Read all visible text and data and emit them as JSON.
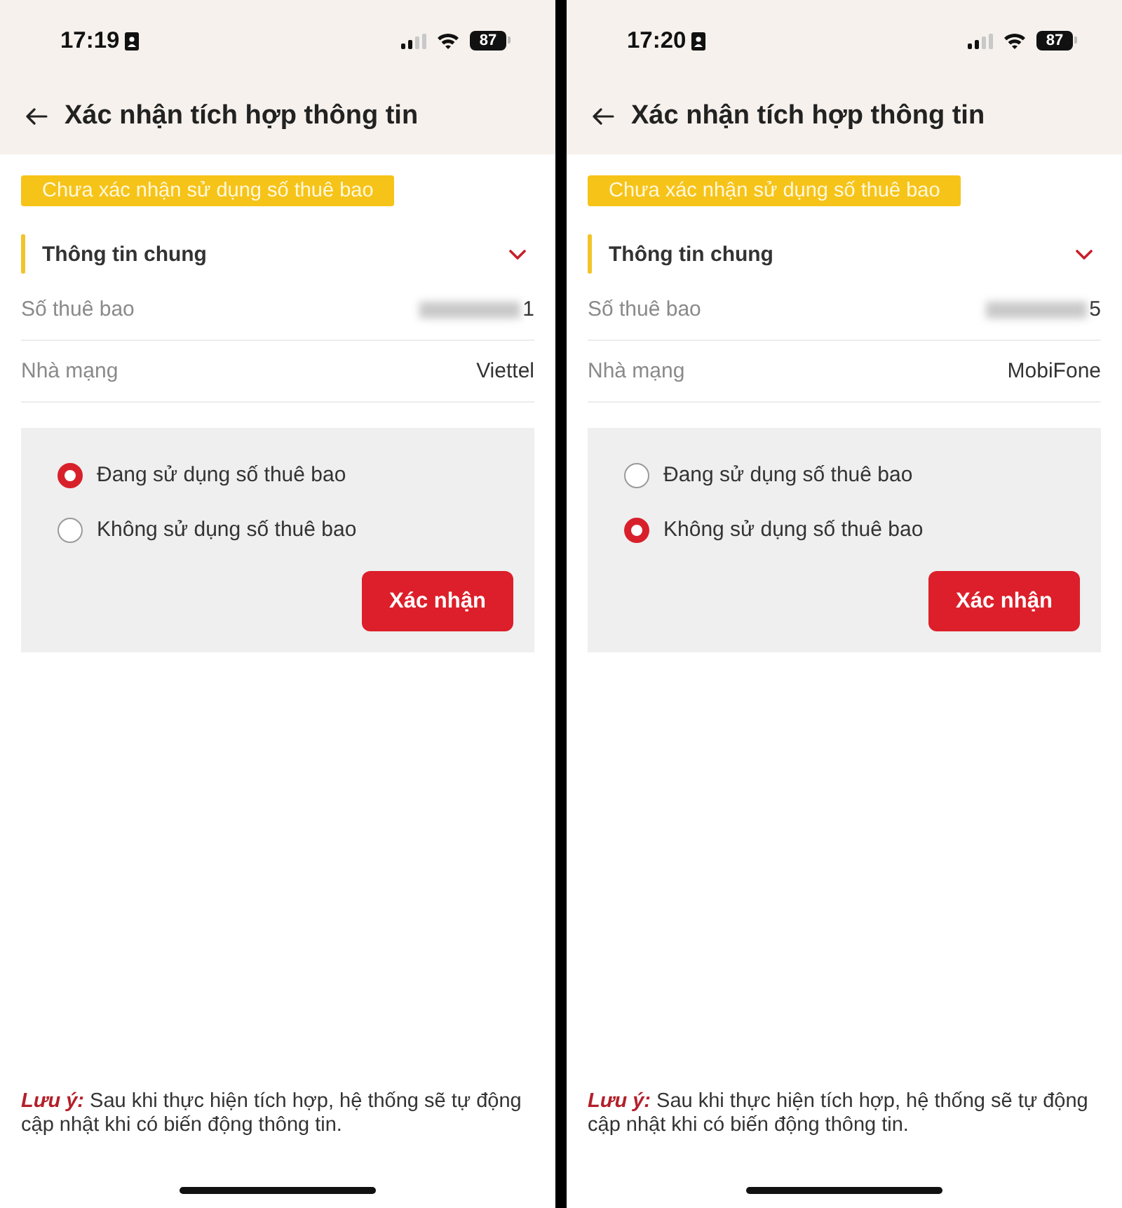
{
  "screens": [
    {
      "status_bar": {
        "time": "17:19",
        "battery": "87"
      },
      "header": {
        "title": "Xác nhận tích hợp thông tin"
      },
      "status_badge": "Chưa xác nhận sử dụng số thuê bao",
      "section": {
        "title": "Thông tin chung"
      },
      "fields": [
        {
          "label": "Số thuê bao",
          "value": "1",
          "redacted": true
        },
        {
          "label": "Nhà mạng",
          "value": "Viettel"
        }
      ],
      "options": [
        {
          "label": "Đang sử dụng số thuê bao",
          "selected": true
        },
        {
          "label": "Không sử dụng số thuê bao",
          "selected": false
        }
      ],
      "confirm_button": "Xác nhận",
      "note": "**Lưu ý:** Sau khi thực hiện tích hợp, hệ thống sẽ tự động cập nhật khi có biến động thông tin."
    },
    {
      "status_bar": {
        "time": "17:20",
        "battery": "87"
      },
      "header": {
        "title": "Xác nhận tích hợp thông tin"
      },
      "status_badge": "Chưa xác nhận sử dụng số thuê bao",
      "section": {
        "title": "Thông tin chung"
      },
      "fields": [
        {
          "label": "Số thuê bao",
          "value": "5",
          "redacted": true
        },
        {
          "label": "Nhà mạng",
          "value": "MobiFone"
        }
      ],
      "options": [
        {
          "label": "Đang sử dụng số thuê bao",
          "selected": false
        },
        {
          "label": "Không sử dụng số thuê bao",
          "selected": true
        }
      ],
      "confirm_button": "Xác nhận",
      "note": "**Lưu ý:** Sau khi thực hiện tích hợp, hệ thống sẽ tự động cập nhật khi có biến động thông tin."
    }
  ]
}
